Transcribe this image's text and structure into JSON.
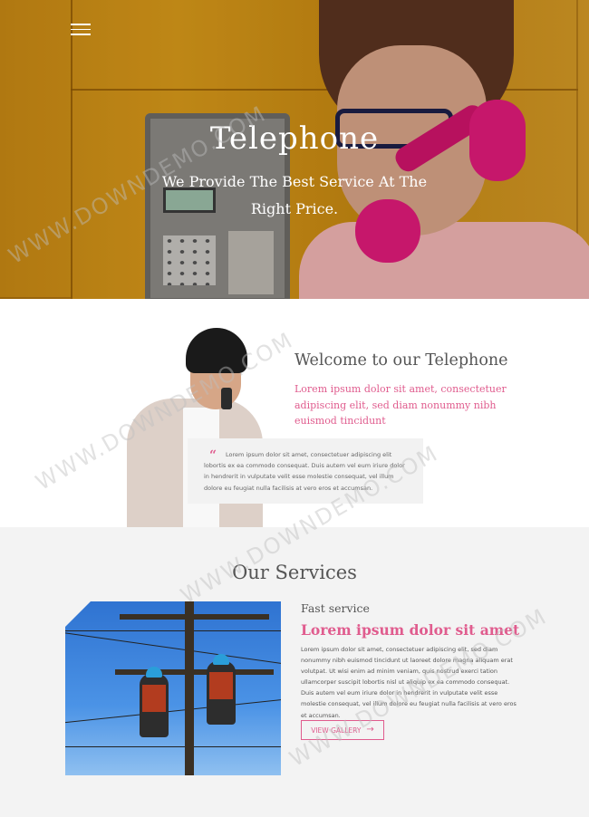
{
  "hero": {
    "title": "Telephone",
    "subtitle": "We Provide The Best Service At The Right Price."
  },
  "welcome": {
    "title": "Welcome to our Telephone",
    "lead": "Lorem ipsum dolor sit amet, consectetuer adipiscing elit, sed diam nonummy nibh euismod tincidunt",
    "quote_mark": "“",
    "quote": "Lorem ipsum dolor sit amet, consectetuer adipiscing elit lobortis ex ea commodo consequat. Duis autem vel eum iriure dolor in hendrerit in vulputate velit esse molestie consequat, vel illum dolore eu feugiat nulla facilisis at vero eros et accumsan."
  },
  "services": {
    "title": "Our Services",
    "kicker": "Fast service",
    "heading": "Lorem ipsum dolor sit amet",
    "text": "Lorem ipsum dolor sit amet, consectetuer adipiscing elit, sed diam nonummy nibh euismod tincidunt ut laoreet dolore magna aliquam erat volutpat. Ut wisi enim ad minim veniam, quis nostrud exerci tation ullamcorper suscipit lobortis nisl ut aliquip ex ea commodo consequat. Duis autem vel eum iriure dolor in hendrerit in vulputate velit esse molestie consequat, vel illum dolore eu feugiat nulla facilisis at vero eros et accumsan.",
    "button": "VIEW GALLERY",
    "button_arrow": "→"
  },
  "watermark": "WWW.DOWNDEMO.COM",
  "colors": {
    "accent": "#e05c8e",
    "text": "#555555",
    "section_bg": "#f3f3f3"
  },
  "icons": {
    "menu": "hamburger-icon",
    "arrow": "arrow-right-icon",
    "quote": "quote-icon"
  }
}
